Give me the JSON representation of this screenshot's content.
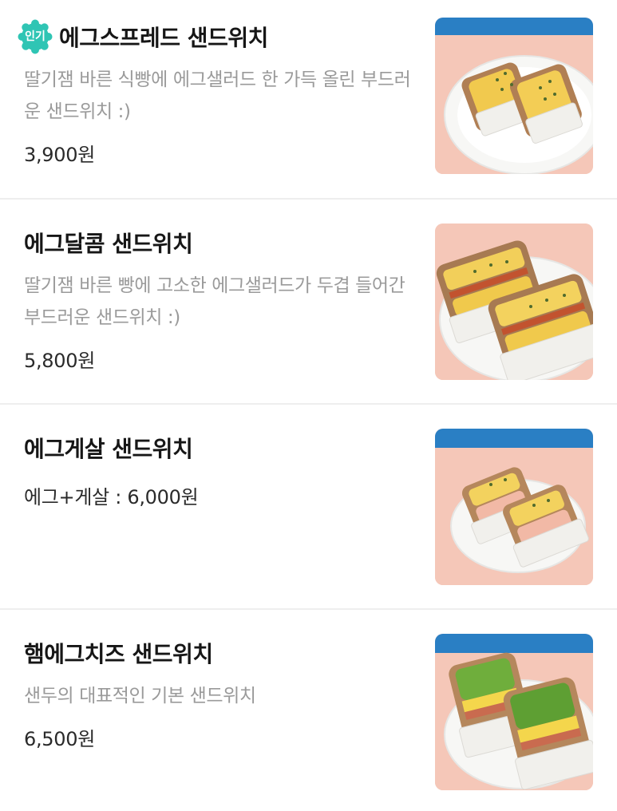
{
  "menu": {
    "items": [
      {
        "badge": "인기",
        "name": "에그스프레드 샌드위치",
        "description": "딸기잼 바른 식빵에 에그샐러드 한 가득 올린 부드러운 샌드위치 :)",
        "price": "3,900원",
        "photo": "egg-spread-sandwich-photo"
      },
      {
        "name": "에그달콤 샌드위치",
        "description": "딸기잼 바른 빵에 고소한 에그샐러드가 두겹 들어간 부드러운 샌드위치 :)",
        "price": "5,800원",
        "photo": "egg-sweet-sandwich-photo"
      },
      {
        "name": "에그게살 샌드위치",
        "price": "에그+게살 : 6,000원",
        "photo": "egg-crab-sandwich-photo"
      },
      {
        "name": "햄에그치즈 샌드위치",
        "description": "샌두의 대표적인 기본 샌드위치",
        "price": "6,500원",
        "photo": "ham-egg-cheese-sandwich-photo"
      }
    ]
  },
  "colors": {
    "badge": "#2fc5b4",
    "photo_bg": "#f5c7b8",
    "photo_accent": "#2a7fc4"
  }
}
